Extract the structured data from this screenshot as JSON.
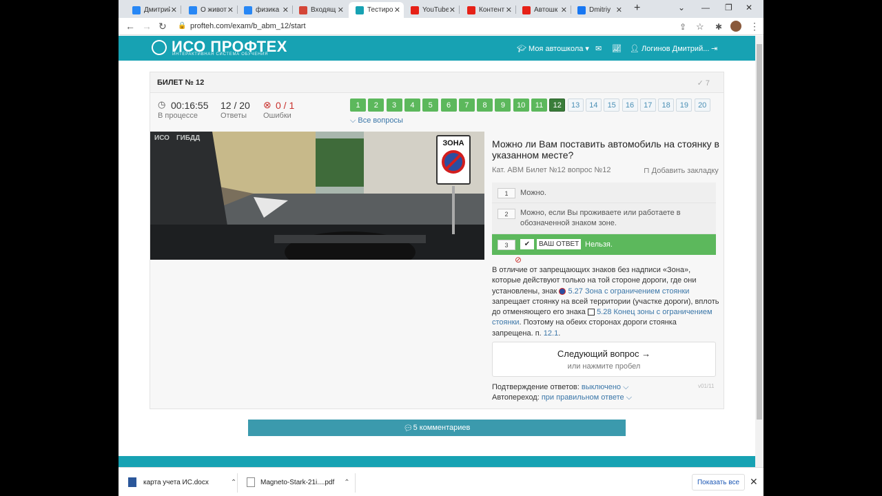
{
  "browser": {
    "tabs": [
      {
        "title": "Дмитрий",
        "icon": "vk-icon",
        "color": "#2787f5"
      },
      {
        "title": "О живот",
        "icon": "vk-icon",
        "color": "#2787f5"
      },
      {
        "title": "физика",
        "icon": "vk-icon",
        "color": "#2787f5"
      },
      {
        "title": "Входящ",
        "icon": "gmail-icon",
        "color": "#d44638"
      },
      {
        "title": "Тестиро",
        "icon": "profteh-icon",
        "color": "#17a2b3",
        "active": true
      },
      {
        "title": "YouTube",
        "icon": "youtube-icon",
        "color": "#e62117"
      },
      {
        "title": "Контент",
        "icon": "youtube-icon",
        "color": "#e62117"
      },
      {
        "title": "Автошк",
        "icon": "youtube-icon",
        "color": "#e62117"
      },
      {
        "title": "Dmitriy",
        "icon": "facebook-icon",
        "color": "#1877f2"
      }
    ],
    "url": "profteh.com/exam/b_abm_12/start"
  },
  "site": {
    "logo_title": "ИСО ПРОФТЕХ",
    "logo_sub": "ИНТЕРАКТИВНАЯ СИСТЕМА ОБУЧЕНИЯ",
    "nav_school": "Моя автошкола",
    "nav_user": "Логинов Дмитрий..."
  },
  "exam": {
    "ticket_title": "БИЛЕТ № 12",
    "check_count": "7",
    "timer": "00:16:55",
    "timer_label": "В процессе",
    "answers": "12 / 20",
    "answers_label": "Ответы",
    "errors": "0 / 1",
    "errors_label": "Ошибки",
    "questions": [
      {
        "n": "1",
        "state": "ok"
      },
      {
        "n": "2",
        "state": "ok"
      },
      {
        "n": "3",
        "state": "ok"
      },
      {
        "n": "4",
        "state": "ok"
      },
      {
        "n": "5",
        "state": "ok"
      },
      {
        "n": "6",
        "state": "ok"
      },
      {
        "n": "7",
        "state": "ok"
      },
      {
        "n": "8",
        "state": "ok"
      },
      {
        "n": "9",
        "state": "ok"
      },
      {
        "n": "10",
        "state": "ok"
      },
      {
        "n": "11",
        "state": "ok"
      },
      {
        "n": "12",
        "state": "cur"
      },
      {
        "n": "13",
        "state": "pend"
      },
      {
        "n": "14",
        "state": "pend"
      },
      {
        "n": "15",
        "state": "pend"
      },
      {
        "n": "16",
        "state": "pend"
      },
      {
        "n": "17",
        "state": "pend"
      },
      {
        "n": "18",
        "state": "pend"
      },
      {
        "n": "19",
        "state": "pend"
      },
      {
        "n": "20",
        "state": "pend"
      }
    ],
    "all_questions": "Все вопросы",
    "photo_wm1": "ИСО",
    "photo_wm2": "ГИБДД",
    "sign_text": "ЗОНА",
    "question": "Можно ли Вам поставить автомобиль на стоянку в указанном месте?",
    "meta": "Кат. ABM   Билет №12   вопрос №12",
    "bookmark": "Добавить закладку",
    "answer_options": [
      {
        "n": "1",
        "text": "Можно."
      },
      {
        "n": "2",
        "text": "Можно, если Вы проживаете или работаете в обозначенной знаком зоне."
      },
      {
        "n": "3",
        "text": "Нельзя.",
        "badge": "ВАШ ОТВЕТ"
      }
    ],
    "expl_1": "В отличие от запрещающих знаков без надписи «Зона», которые действуют только на той стороне дороги, где они установлены, знак",
    "expl_link1": "5.27 Зона с ограничением стоянки",
    "expl_2": "запрещает стоянку на всей территории (участке дороги), вплоть до отменяющего его знака",
    "expl_link2": "5.28 Конец зоны с ограничением стоянки",
    "expl_3": ". Поэтому на обеих сторонах дороги стоянка запрещена.",
    "expl_p": "п.",
    "expl_link3": "12.1",
    "next_title": "Следующий вопрос →",
    "next_sub": "или нажмите пробел",
    "version": "v01/11",
    "confirm_label": "Подтверждение ответов:",
    "confirm_value": "выключено",
    "auto_label": "Автопереход:",
    "auto_value": "при правильном ответе",
    "comments": "5 комментариев"
  },
  "downloads": {
    "file1": "карта учета ИС.docx",
    "file2": "Magneto-Stark-21i....pdf",
    "show_all": "Показать все"
  }
}
